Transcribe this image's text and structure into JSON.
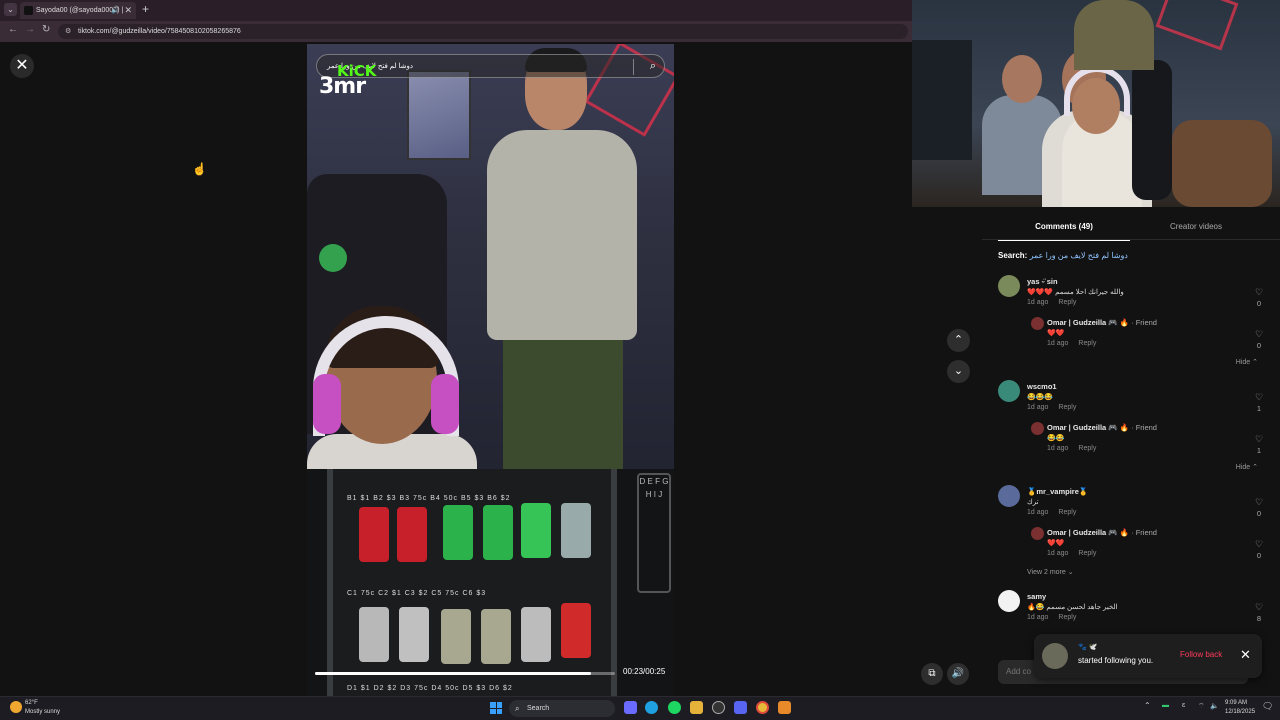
{
  "browser": {
    "tab_title": "Sayoda00 (@sayoda0001) |",
    "url": "tiktok.com/@gudzeilla/video/7584508102058265876",
    "new_tab": "+",
    "tab_close": "✕"
  },
  "video": {
    "search_text": "دوشا لم فتح لايف من ورا عمر",
    "kick_word": "KiCK",
    "kick_name": "3mr",
    "shelf_b": "B1 $1  B2 $3  B3 75c  B4 50c  B5 $3  B6 $2",
    "shelf_c": "C1 75c  C2 $1  C3 $2  C5 75c  C6 $3",
    "shelf_d": "D1 $1  D2 $2  D3 75c  D4 50c  D5 $3  D6 $2",
    "keypad": "D E F G H I J",
    "time": "00:23/00:25",
    "progress": 0.92
  },
  "comments_panel": {
    "tab_comments": "Comments (49)",
    "tab_creator": "Creator videos",
    "search_label": "Search:",
    "search_query": "دوشا لم فتح لايف من ورا عمر",
    "add_comment_placeholder": "Add co",
    "hide_label": "Hide ⌃",
    "view_more": "View 2 more ⌄",
    "comments": [
      {
        "user": "yas ᵕ̈ sin",
        "text": "❤️❤️❤️ والله جيرانك احلا مسمم",
        "age": "1d ago",
        "reply": "Reply",
        "likes": "0",
        "reply_user": "Omar | Gudzeilla 🎮 🔥",
        "reply_tag": "· Friend",
        "reply_text": "❤️❤️",
        "reply_age": "1d ago",
        "reply_reply": "Reply",
        "reply_likes": "0"
      },
      {
        "user": "wscmo1",
        "text": "😂😂😂",
        "age": "1d ago",
        "reply": "Reply",
        "likes": "1",
        "reply_user": "Omar | Gudzeilla 🎮 🔥",
        "reply_tag": "· Friend",
        "reply_text": "😂😂",
        "reply_age": "1d ago",
        "reply_reply": "Reply",
        "reply_likes": "1"
      },
      {
        "user": "🥇mr_vampire🥇",
        "text": "ترك",
        "age": "1d ago",
        "reply": "Reply",
        "likes": "0",
        "reply_user": "Omar | Gudzeilla 🎮 🔥",
        "reply_tag": "· Friend",
        "reply_text": "❤️❤️",
        "reply_age": "1d ago",
        "reply_reply": "Reply",
        "reply_likes": "0"
      },
      {
        "user": "samy",
        "text": "🔥😂 الخير جاهد لحسن مسمم",
        "age": "1d ago",
        "reply": "Reply",
        "likes": "8"
      }
    ]
  },
  "toast": {
    "name": "🐾 🕊️",
    "text": "started following you.",
    "follow_back": "Follow back",
    "close": "✕"
  },
  "taskbar": {
    "temp": "62°F",
    "weather": "Mostly sunny",
    "search": "Search",
    "time": "9:09 AM",
    "date": "12/18/2025"
  }
}
